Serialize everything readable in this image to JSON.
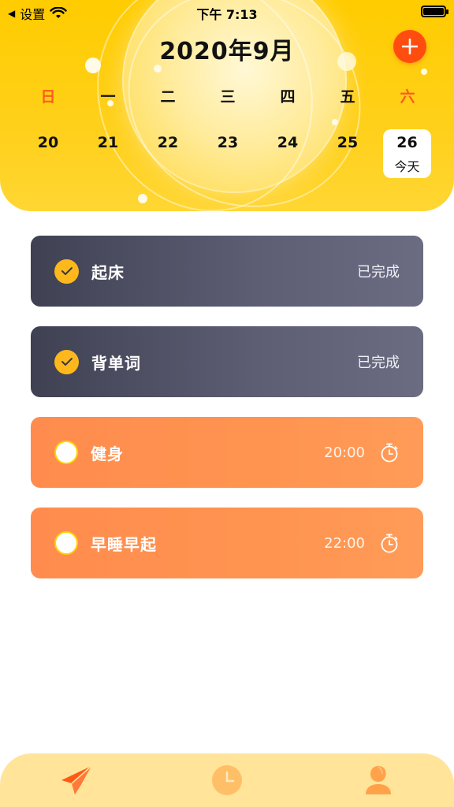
{
  "status_bar": {
    "back_label": "设置",
    "time": "下午 7:13"
  },
  "header": {
    "month_title": "2020年9月"
  },
  "weekdays": [
    "日",
    "一",
    "二",
    "三",
    "四",
    "五",
    "六"
  ],
  "dates": [
    {
      "day": "20",
      "sub": ""
    },
    {
      "day": "21",
      "sub": ""
    },
    {
      "day": "22",
      "sub": ""
    },
    {
      "day": "23",
      "sub": ""
    },
    {
      "day": "24",
      "sub": ""
    },
    {
      "day": "25",
      "sub": ""
    },
    {
      "day": "26",
      "sub": "今天"
    }
  ],
  "tasks": [
    {
      "title": "起床",
      "status": "已完成",
      "time": ""
    },
    {
      "title": "背单词",
      "status": "已完成",
      "time": ""
    },
    {
      "title": "健身",
      "status": "",
      "time": "20:00"
    },
    {
      "title": "早睡早起",
      "status": "",
      "time": "22:00"
    }
  ],
  "colors": {
    "header_yellow": "#ffcc00",
    "accent_orange": "#ff4d10",
    "done_card": "#4a4b5f",
    "pending_card": "#ff8f50",
    "tabbar": "#ffe49a"
  },
  "icons": {
    "tab_1": "send-icon",
    "tab_2": "clock-icon",
    "tab_3": "user-icon"
  }
}
